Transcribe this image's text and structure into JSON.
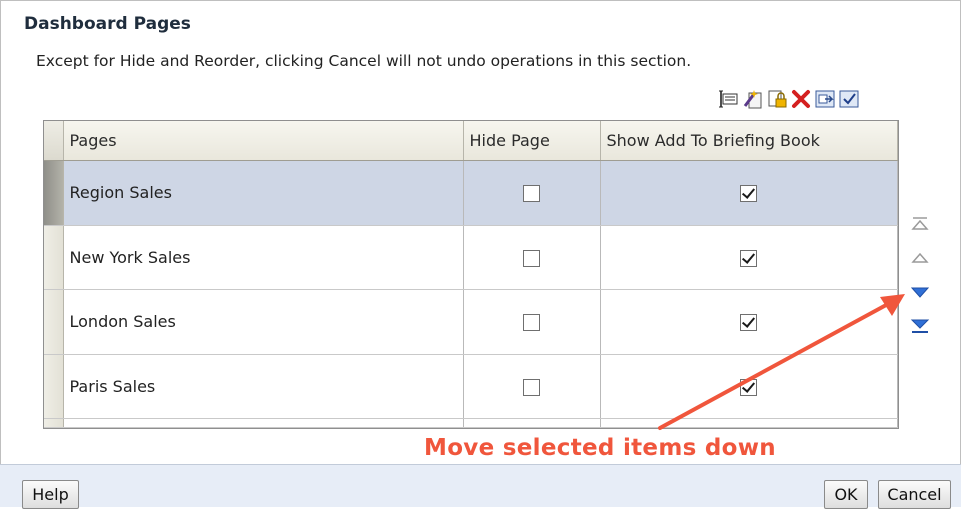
{
  "dialog": {
    "title": "Dashboard Pages",
    "description": "Except for Hide and Reorder, clicking Cancel will not undo operations in this section."
  },
  "toolbar": {
    "icons": [
      "page-properties-icon",
      "wizard-icon",
      "permissions-icon",
      "delete-icon",
      "move-page-icon",
      "select-all-icon"
    ]
  },
  "table": {
    "columns": [
      "Pages",
      "Hide Page",
      "Show Add To Briefing Book"
    ],
    "rows": [
      {
        "name": "Region Sales",
        "hide_page": false,
        "show_briefing_book": true,
        "selected": true
      },
      {
        "name": "New York Sales",
        "hide_page": false,
        "show_briefing_book": true,
        "selected": false
      },
      {
        "name": "London Sales",
        "hide_page": false,
        "show_briefing_book": true,
        "selected": false
      },
      {
        "name": "Paris Sales",
        "hide_page": false,
        "show_briefing_book": true,
        "selected": false
      }
    ]
  },
  "reorder": {
    "buttons": [
      "move-to-top-icon",
      "move-up-icon",
      "move-down-icon",
      "move-to-bottom-icon"
    ]
  },
  "annotation": {
    "text": "Move selected items down",
    "color": "#f0563c"
  },
  "footer": {
    "help_label": "Help",
    "ok_label": "OK",
    "cancel_label": "Cancel"
  }
}
